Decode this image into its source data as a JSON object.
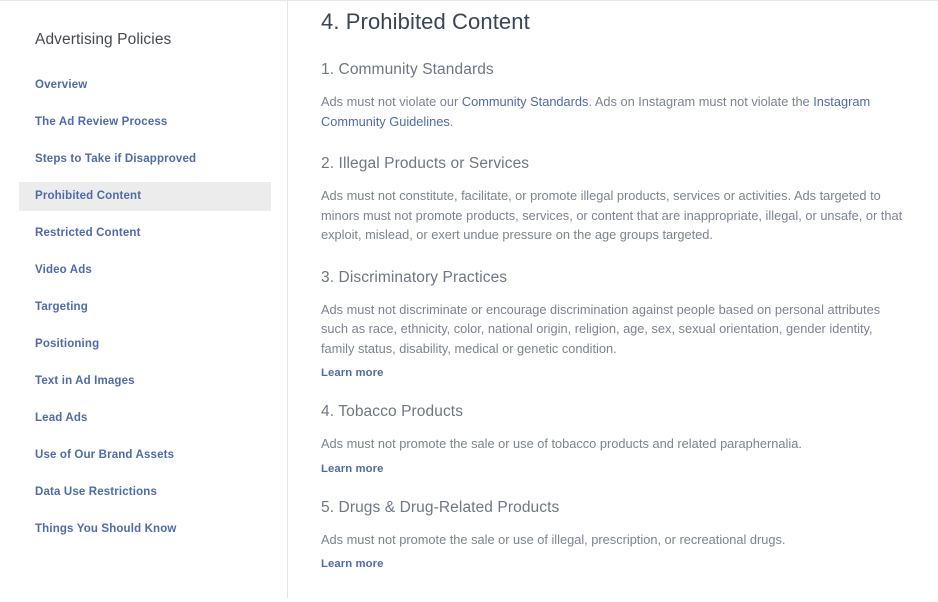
{
  "sidebar": {
    "title": "Advertising Policies",
    "items": [
      {
        "label": "Overview",
        "active": false
      },
      {
        "label": "The Ad Review Process",
        "active": false
      },
      {
        "label": "Steps to Take if Disapproved",
        "active": false
      },
      {
        "label": "Prohibited Content",
        "active": true
      },
      {
        "label": "Restricted Content",
        "active": false
      },
      {
        "label": "Video Ads",
        "active": false
      },
      {
        "label": "Targeting",
        "active": false
      },
      {
        "label": "Positioning",
        "active": false
      },
      {
        "label": "Text in Ad Images",
        "active": false
      },
      {
        "label": "Lead Ads",
        "active": false
      },
      {
        "label": "Use of Our Brand Assets",
        "active": false
      },
      {
        "label": "Data Use Restrictions",
        "active": false
      },
      {
        "label": "Things You Should Know",
        "active": false
      }
    ]
  },
  "main": {
    "title": "4. Prohibited Content",
    "sections": [
      {
        "heading": "1. Community Standards",
        "body_part_1": "Ads must not violate our ",
        "link_1": "Community Standards",
        "body_part_2": ". Ads on Instagram must not violate the ",
        "link_2": "Instagram Community Guidelines",
        "body_part_3": ".",
        "learn_more": ""
      },
      {
        "heading": "2. Illegal Products or Services",
        "body": "Ads must not constitute, facilitate, or promote illegal products, services or activities. Ads targeted to minors must not promote products, services, or content that are inappropriate, illegal, or unsafe, or that exploit, mislead, or exert undue pressure on the age groups targeted.",
        "learn_more": ""
      },
      {
        "heading": "3. Discriminatory Practices",
        "body": "Ads must not discriminate or encourage discrimination against people based on personal attributes such as race, ethnicity, color, national origin, religion, age, sex, sexual orientation, gender identity, family status, disability, medical or genetic condition.",
        "learn_more": "Learn more"
      },
      {
        "heading": "4. Tobacco Products",
        "body": "Ads must not promote the sale or use of tobacco products and related paraphernalia.",
        "learn_more": "Learn more"
      },
      {
        "heading": "5. Drugs & Drug-Related Products",
        "body": "Ads must not promote the sale or use of illegal, prescription, or recreational drugs.",
        "learn_more": "Learn more"
      }
    ]
  },
  "colors": {
    "link": "#4e6ba8",
    "page_title": "#3b4452",
    "section_title": "#6f7785",
    "body_text": "#7c8391",
    "active_background": "#ececec",
    "divider": "#e4e4e4"
  }
}
